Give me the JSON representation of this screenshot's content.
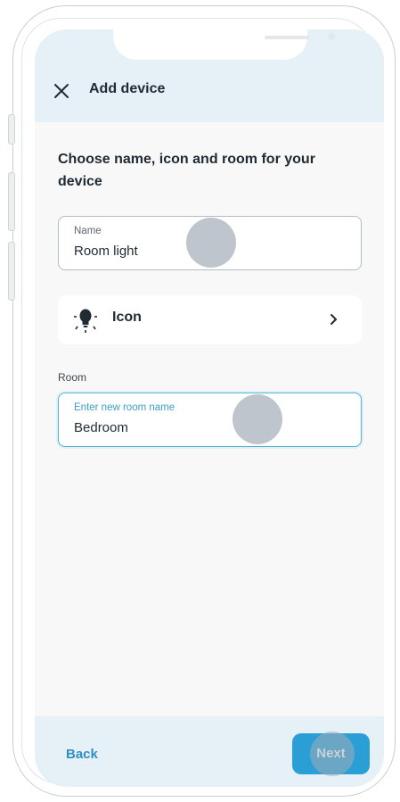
{
  "header": {
    "title": "Add device"
  },
  "main": {
    "heading": "Choose name, icon and room for your device",
    "name_field": {
      "label": "Name",
      "value": "Room light"
    },
    "icon_row": {
      "label": "Icon"
    },
    "room_section": {
      "label": "Room"
    },
    "room_field": {
      "label": "Enter new room name",
      "value": "Bedroom"
    }
  },
  "footer": {
    "back_label": "Back",
    "next_label": "Next"
  },
  "colors": {
    "accent": "#2a9fd6",
    "header_bg": "#e5f1f7",
    "focus_border": "#5ab3d3"
  },
  "icons": {
    "close": "close-icon",
    "bulb": "light-bulb-icon",
    "chevron": "chevron-right-icon"
  }
}
